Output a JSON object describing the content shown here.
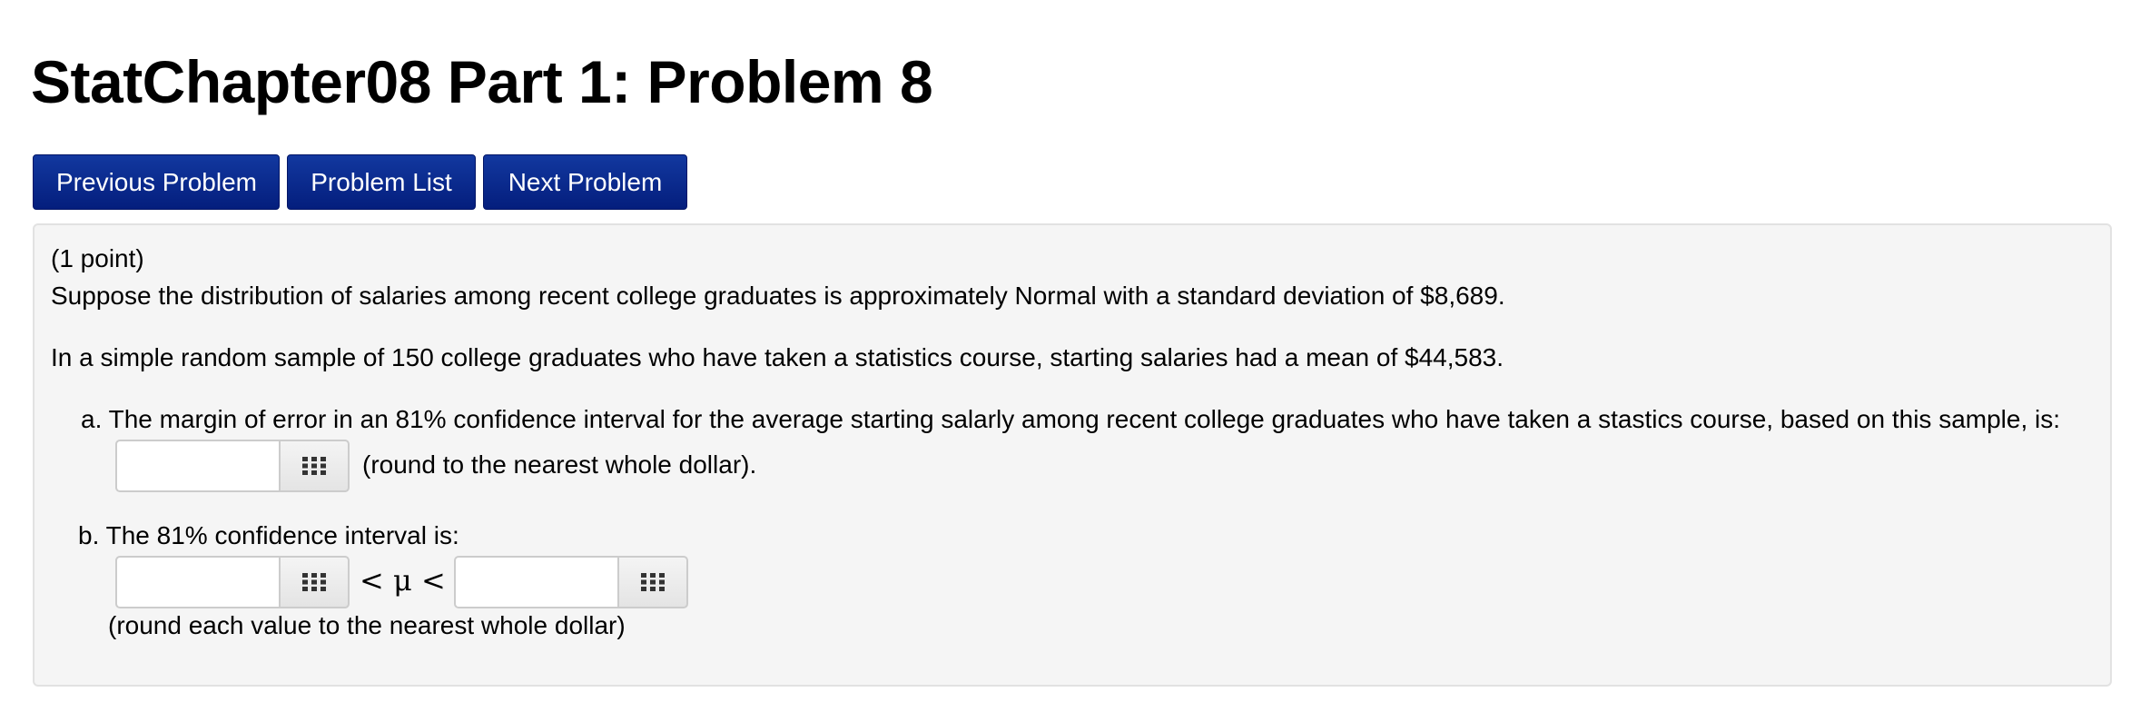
{
  "page": {
    "title": "StatChapter08 Part 1: Problem 8"
  },
  "nav": {
    "previous_label": "Previous Problem",
    "list_label": "Problem List",
    "next_label": "Next Problem",
    "button_color": "#0a2a91"
  },
  "problem": {
    "points": "(1 point)",
    "intro": "Suppose the distribution of salaries among recent college graduates is approximately Normal with a standard deviation of $8,689.",
    "sample": "In a simple random sample of 150 college graduates who have taken a statistics course, starting salaries had a mean of $44,583.",
    "part_a": {
      "prompt": "a. The margin of error in an 81% confidence interval for the average starting salarly among recent college graduates who have taken a stastics course, based on this sample, is:",
      "answer_value": "",
      "note": "(round to the nearest whole dollar).",
      "keypad_icon": "keypad-icon"
    },
    "part_b": {
      "prompt": "b. The 81% confidence interval is:",
      "lower_value": "",
      "upper_value": "",
      "relation": "< μ <",
      "note": "(round each value to the nearest whole dollar)",
      "keypad_icon": "keypad-icon"
    }
  }
}
